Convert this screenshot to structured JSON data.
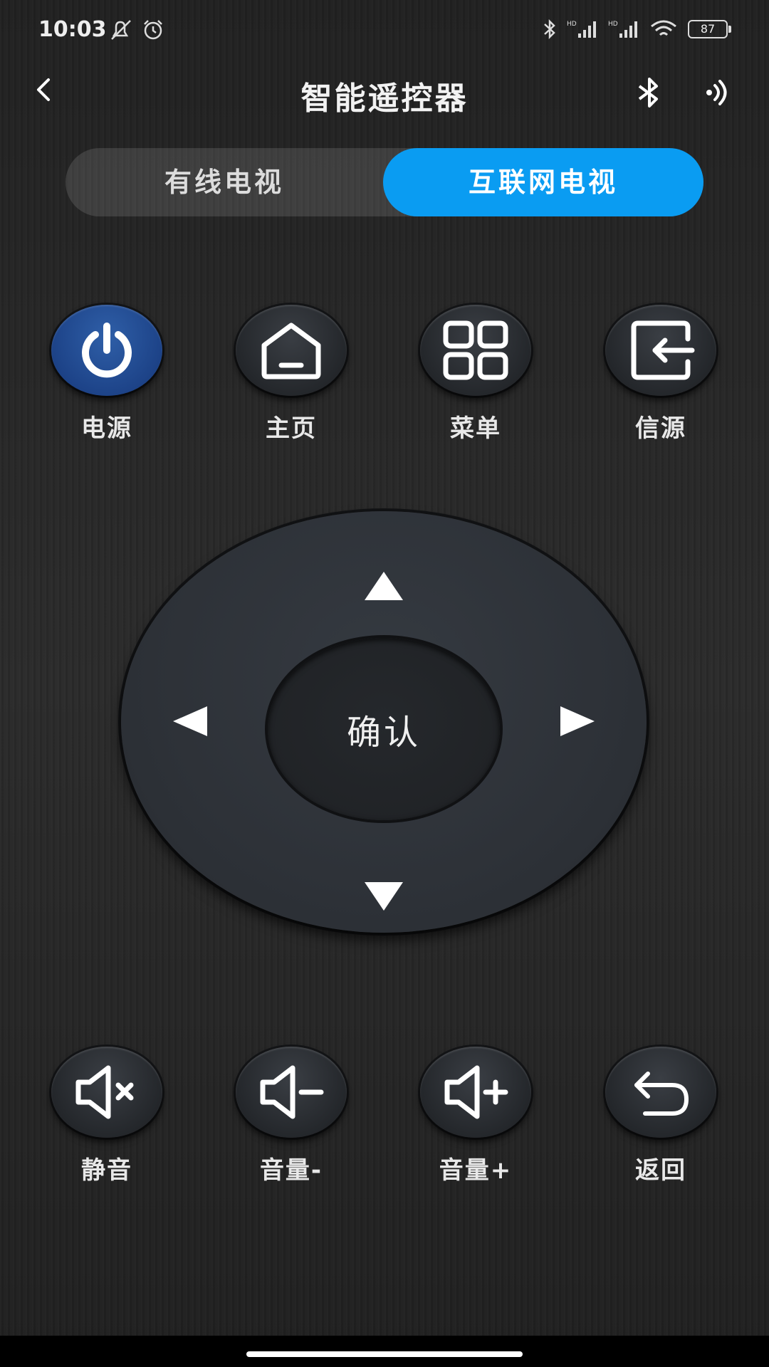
{
  "status": {
    "time": "10:03",
    "battery": "87"
  },
  "header": {
    "title": "智能遥控器"
  },
  "tabs": [
    {
      "label": "有线电视"
    },
    {
      "label": "互联网电视"
    }
  ],
  "top_buttons": [
    {
      "label": "电源"
    },
    {
      "label": "主页"
    },
    {
      "label": "菜单"
    },
    {
      "label": "信源"
    }
  ],
  "dpad": {
    "ok_label": "确认"
  },
  "bottom_buttons": [
    {
      "label": "静音"
    },
    {
      "label": "音量-"
    },
    {
      "label": "音量+"
    },
    {
      "label": "返回"
    }
  ],
  "colors": {
    "accent": "#0a9cf2",
    "power": "#1d4388",
    "background": "#262626"
  }
}
